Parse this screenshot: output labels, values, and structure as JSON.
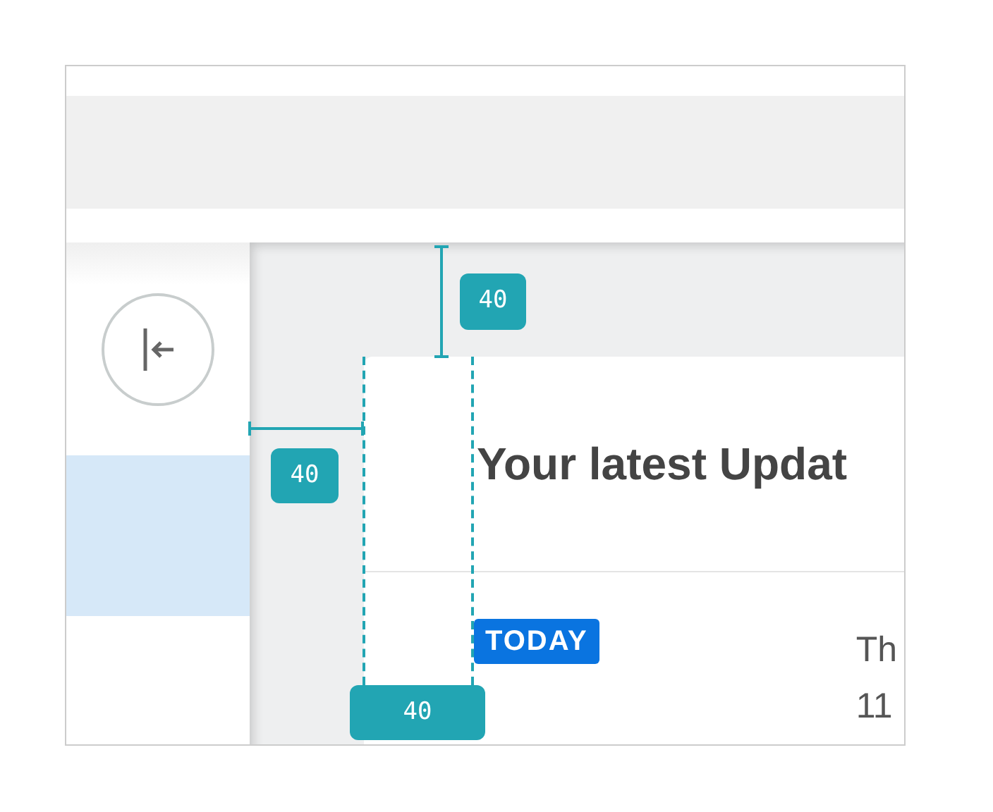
{
  "sidebar": {
    "items": [
      {
        "selected": true
      }
    ]
  },
  "card": {
    "heading": "Your latest Updat",
    "updates": [
      {
        "badge": "TODAY",
        "lines": [
          "Th",
          "11"
        ]
      }
    ]
  },
  "annotations": [
    {
      "kind": "vertical",
      "label": "40"
    },
    {
      "kind": "horizontal",
      "label": "40"
    },
    {
      "kind": "width",
      "label": "40"
    }
  ]
}
